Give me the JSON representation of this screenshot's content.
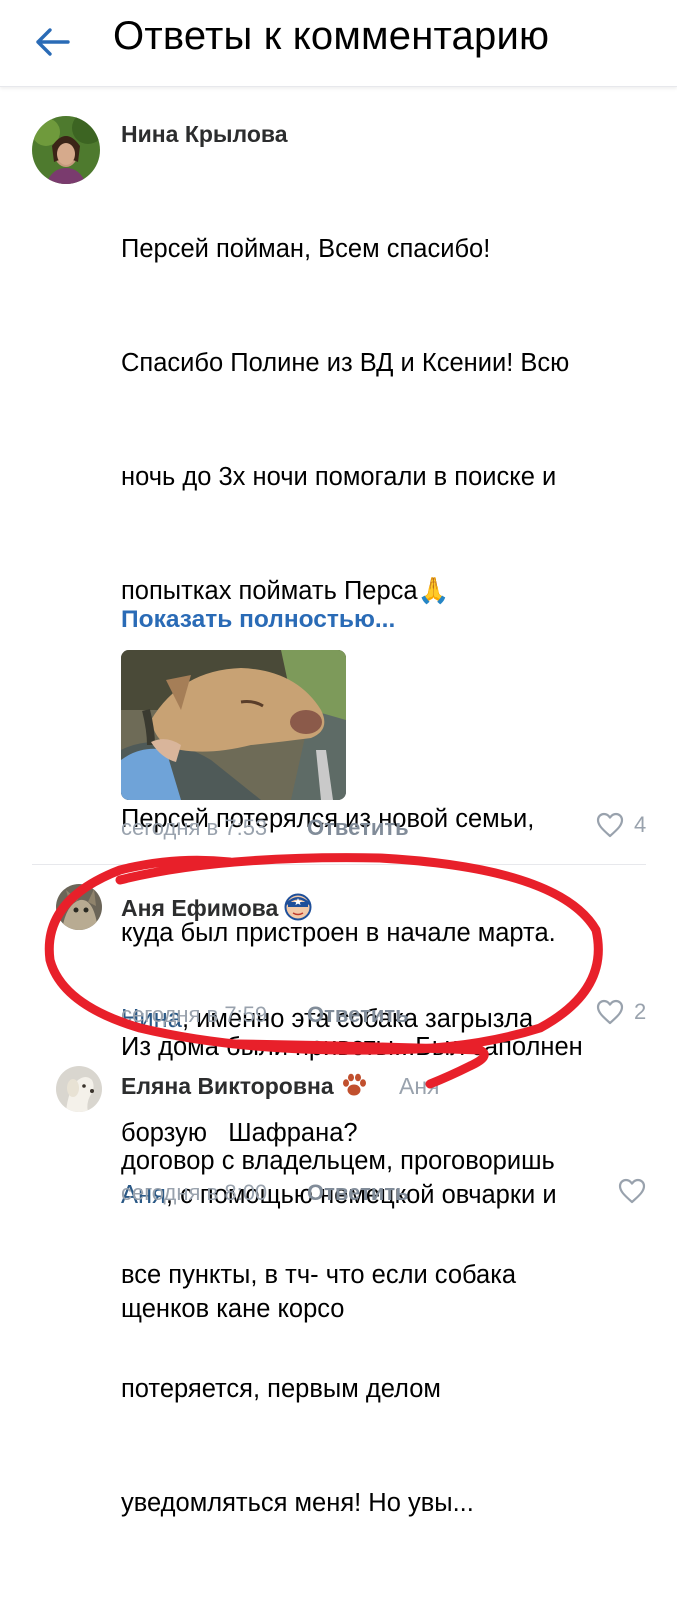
{
  "header": {
    "title": "Ответы к комментарию",
    "back_icon": "arrow-left-icon"
  },
  "colors": {
    "accent": "#2a6bb6",
    "secondary_text": "#99a2ad",
    "annotation": "#e8202a"
  },
  "comments": [
    {
      "author": "Нина Крылова",
      "lines": [
        "Персей пойман, Всем спасибо!",
        "Спасибо Полине из ВД и Ксении! Всю",
        "ночь до 3х ночи помогали в поиске и",
        "попытках поймать Перса",
        "",
        "Персей потерялся из новой семьи,",
        "куда был пристроен в начале марта.",
        "Из дома были приветы...Был заполнен",
        "договор с владельцем, проговоришь",
        "все пункты, в тч- что если собака",
        "потеряется, первым делом",
        "уведомляться меня! Но увы..."
      ],
      "emoji": "🙏",
      "show_more": "Показать полностью...",
      "time": "сегодня в 7:53",
      "reply_label": "Ответить",
      "likes": "4"
    },
    {
      "author": "Аня Ефимова",
      "badge": "🧢",
      "mention": "Нина",
      "text_after_mention": ", именно эта собака загрызла",
      "line2": "борзую   Шафрана?",
      "time": "сегодня в 7:59",
      "reply_label": "Ответить",
      "likes": "2"
    },
    {
      "author": "Еляна Викторовна",
      "badge": "🐾",
      "reply_to": "Аня",
      "mention": "Аня",
      "text_after_mention": ", с помощью немецкой овчарки и",
      "line2": "щенков кане корсо",
      "time": "сегодня в 8:00",
      "reply_label": "Ответить"
    }
  ]
}
